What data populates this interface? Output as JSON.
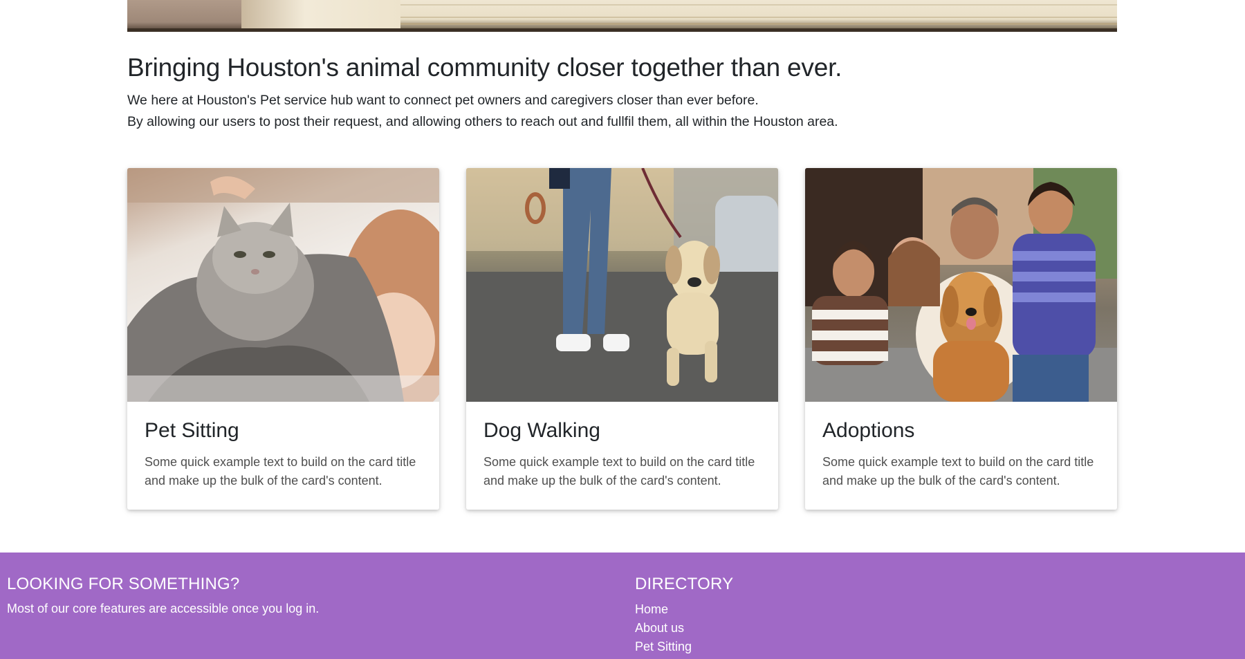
{
  "intro": {
    "heading": "Bringing Houston's animal community closer together than ever.",
    "line1": "We here at Houston's Pet service hub want to connect pet owners and caregivers closer than ever before.",
    "line2": "By allowing our users to post their request, and allowing others to reach out and fullfil them, all within the Houston area."
  },
  "cards": [
    {
      "title": "Pet Sitting",
      "text": "Some quick example text to build on the card title and make up the bulk of the card's content."
    },
    {
      "title": "Dog Walking",
      "text": "Some quick example text to build on the card title and make up the bulk of the card's content."
    },
    {
      "title": "Adoptions",
      "text": "Some quick example text to build on the card title and make up the bulk of the card's content."
    }
  ],
  "footer": {
    "left_heading": "LOOKING FOR SOMETHING?",
    "left_text": "Most of our core features are accessible once you log in.",
    "directory_heading": "DIRECTORY",
    "links": [
      "Home",
      "About us",
      "Pet Sitting"
    ]
  },
  "colors": {
    "footer_bg": "#a069c6",
    "text": "#212529"
  }
}
